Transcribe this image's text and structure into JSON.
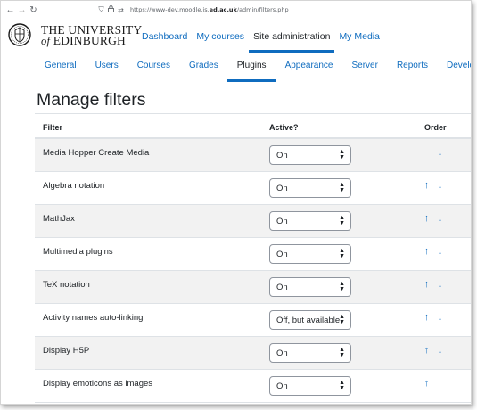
{
  "browser": {
    "url_prefix": "https://www-dev.moodle.is.",
    "url_domain": "ed.ac.uk",
    "url_path": "/admin/filters.php"
  },
  "brand": {
    "line1": "THE UNIVERSITY",
    "line2_of": "of",
    "line2_name": " EDINBURGH"
  },
  "primary_nav": [
    {
      "label": "Dashboard"
    },
    {
      "label": "My courses"
    },
    {
      "label": "Site administration"
    },
    {
      "label": "My Media"
    }
  ],
  "secondary_nav": [
    {
      "label": "General"
    },
    {
      "label": "Users"
    },
    {
      "label": "Courses"
    },
    {
      "label": "Grades"
    },
    {
      "label": "Plugins"
    },
    {
      "label": "Appearance"
    },
    {
      "label": "Server"
    },
    {
      "label": "Reports"
    },
    {
      "label": "Development"
    }
  ],
  "page": {
    "title": "Manage filters"
  },
  "table": {
    "headers": {
      "filter": "Filter",
      "active": "Active?",
      "order": "Order"
    },
    "rows": [
      {
        "name": "Media Hopper Create Media",
        "active": "On"
      },
      {
        "name": "Algebra notation",
        "active": "On"
      },
      {
        "name": "MathJax",
        "active": "On"
      },
      {
        "name": "Multimedia plugins",
        "active": "On"
      },
      {
        "name": "TeX notation",
        "active": "On"
      },
      {
        "name": "Activity names auto-linking",
        "active": "Off, but available"
      },
      {
        "name": "Display H5P",
        "active": "On"
      },
      {
        "name": "Display emoticons as images",
        "active": "On"
      }
    ]
  },
  "colors": {
    "link": "#0f6cbf",
    "text": "#1d2125",
    "stripe": "#f2f2f2"
  }
}
